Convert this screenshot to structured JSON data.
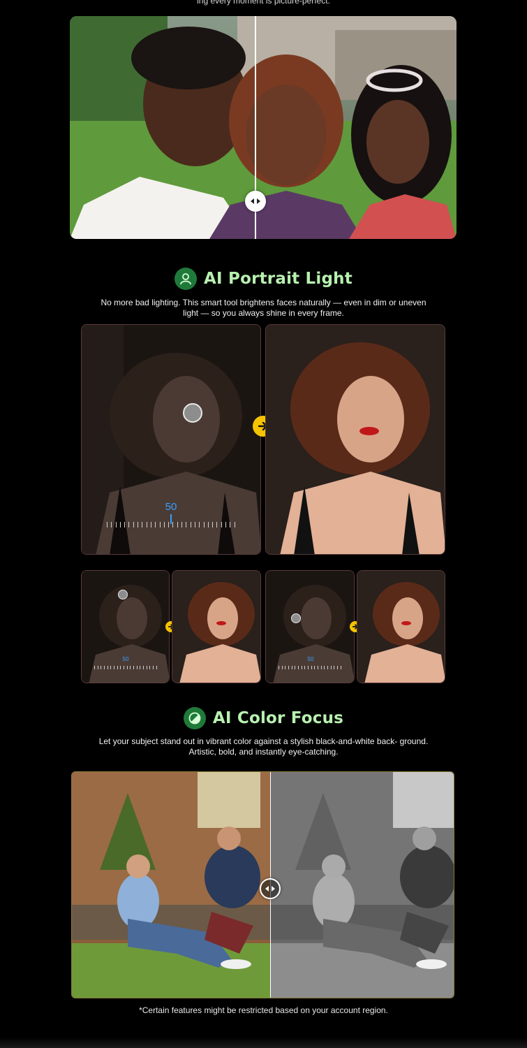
{
  "top_caption": "ing every moment is picture-perfect.",
  "portrait_light": {
    "title": "AI Portrait Light",
    "description": "No more bad lighting. This smart tool brightens faces naturally — even in dim or uneven light — so you always shine in every frame.",
    "slider_value": "50",
    "thumb_slider_value": "50"
  },
  "color_focus": {
    "title": "AI Color Focus",
    "description": "Let your subject stand out in vibrant color against a stylish black-and-white back- ground. Artistic, bold, and instantly eye-catching."
  },
  "footnote": "*Certain features might be restricted based on your account region.",
  "colors": {
    "accent_green": "#b8f0b0",
    "icon_green": "#1f7a3a",
    "arrow_yellow": "#f5c400",
    "slider_blue": "#3aa0ff"
  },
  "icons": [
    "person-icon",
    "color-focus-icon",
    "arrow-right-icon",
    "compare-handle-icon"
  ]
}
